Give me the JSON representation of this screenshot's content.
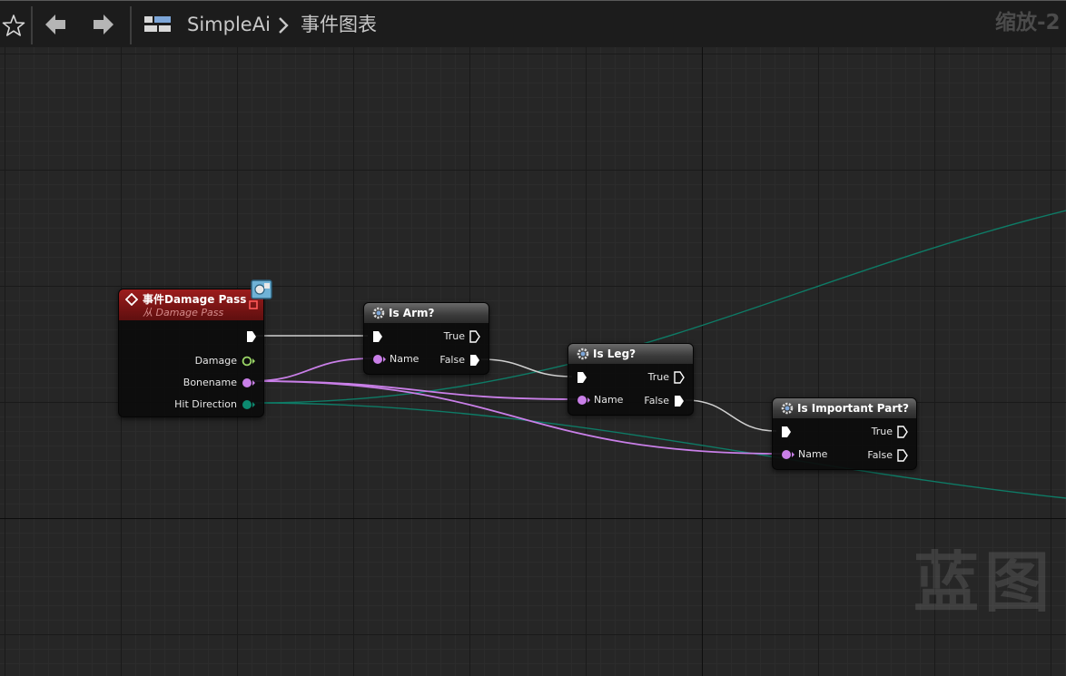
{
  "toolbar": {
    "breadcrumb_root": "SimpleAi",
    "breadcrumb_current": "事件图表",
    "zoom_label": "缩放-2"
  },
  "nodes": {
    "event": {
      "title": "事件Damage Pass",
      "subtitle": "从 Damage Pass",
      "pins": {
        "damage": "Damage",
        "bonename": "Bonename",
        "hit_direction": "Hit Direction"
      }
    },
    "is_arm": {
      "title": "Is Arm?",
      "name_label": "Name",
      "true_label": "True",
      "false_label": "False"
    },
    "is_leg": {
      "title": "Is Leg?",
      "name_label": "Name",
      "true_label": "True",
      "false_label": "False"
    },
    "is_important": {
      "title": "Is Important Part?",
      "name_label": "Name",
      "true_label": "True",
      "false_label": "False"
    }
  },
  "watermark": "蓝图",
  "colors": {
    "exec_pin": "#ffffff",
    "name_pin": "#c97fe8",
    "float_pin": "#9ad566",
    "vector_pin": "#0c8a70",
    "event_header": "#8a1818",
    "function_header": "#4a4a4a"
  },
  "icons": {
    "favorite": "star-icon",
    "back": "arrow-left-icon",
    "forward": "arrow-right-icon",
    "graph": "blueprint-graph-icon",
    "breadcrumb_separator": "chevron-right-icon",
    "event_node": "event-diamond-icon",
    "function_node": "gear-icon"
  }
}
